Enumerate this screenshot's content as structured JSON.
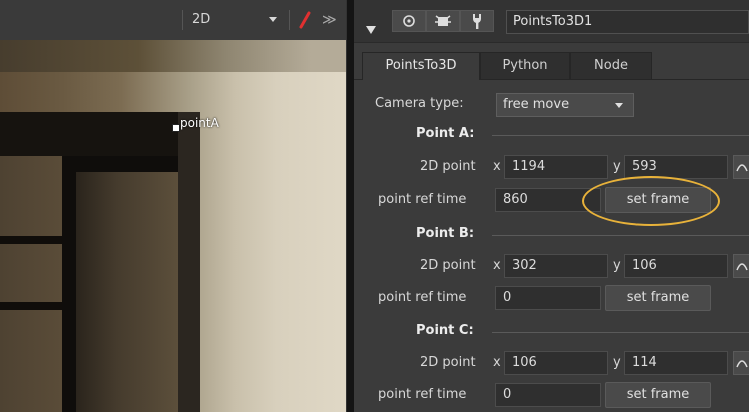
{
  "viewer": {
    "view_mode": "2D",
    "point_label": "pointA"
  },
  "properties": {
    "node_name": "PointsTo3D1",
    "tabs": [
      {
        "label": "PointsTo3D"
      },
      {
        "label": "Python"
      },
      {
        "label": "Node"
      }
    ],
    "camera_type_label": "Camera type:",
    "camera_type_value": "free move",
    "points": [
      {
        "heading": "Point A:",
        "point_label": "2D point",
        "x_label": "x",
        "x": "1194",
        "y_label": "y",
        "y": "593",
        "ref_label": "point ref time",
        "ref_time": "860",
        "button": "set frame"
      },
      {
        "heading": "Point B:",
        "point_label": "2D point",
        "x_label": "x",
        "x": "302",
        "y_label": "y",
        "y": "106",
        "ref_label": "point ref time",
        "ref_time": "0",
        "button": "set frame"
      },
      {
        "heading": "Point C:",
        "point_label": "2D point",
        "x_label": "x",
        "x": "106",
        "y_label": "y",
        "y": "114",
        "ref_label": "point ref time",
        "ref_time": "0",
        "button": "set frame"
      }
    ]
  },
  "colors": {
    "highlight_ring": "#e8b23a",
    "panel_bg": "#3b3b3b",
    "brush_icon": "#e03030"
  }
}
